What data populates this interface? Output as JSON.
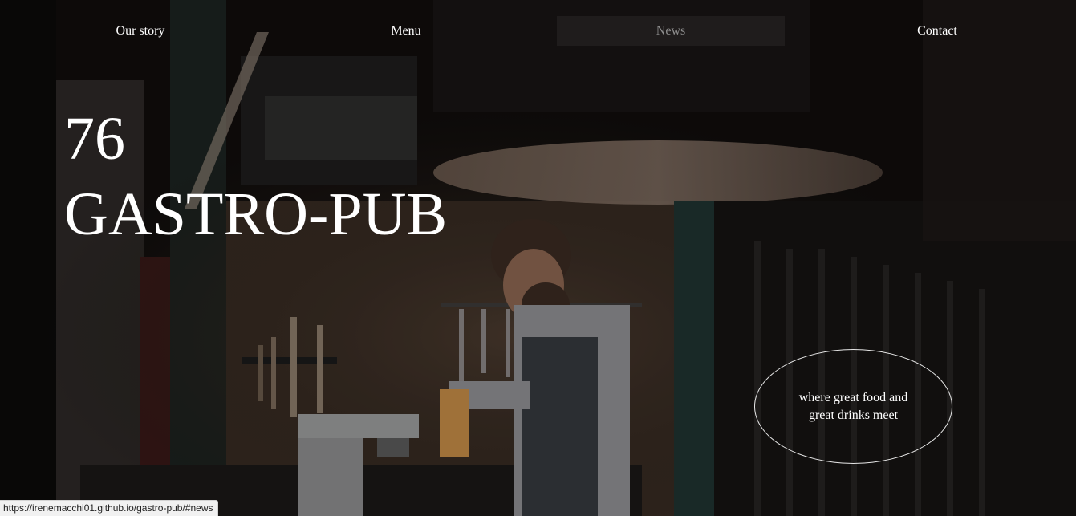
{
  "nav": {
    "items": [
      {
        "label": "Our story",
        "active": false
      },
      {
        "label": "Menu",
        "active": false
      },
      {
        "label": "News",
        "active": true
      },
      {
        "label": "Contact",
        "active": false
      }
    ]
  },
  "hero": {
    "number": "76",
    "name": "GASTRO-PUB",
    "tagline": "where great food and great drinks meet"
  },
  "status_bar": {
    "url": "https://irenemacchi01.github.io/gastro-pub/#news"
  },
  "colors": {
    "text": "#ffffff",
    "nav_active": "#8d8d8d",
    "background": "#0d0b0a"
  }
}
